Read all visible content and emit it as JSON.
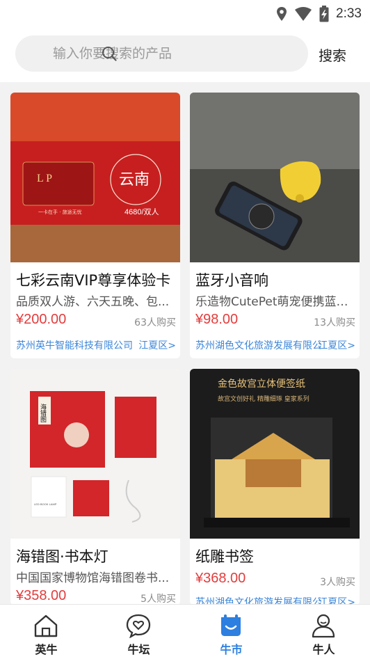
{
  "status_bar": {
    "time": "2:33"
  },
  "search": {
    "placeholder": "输入你要搜索的产品",
    "button_label": "搜索"
  },
  "products": [
    {
      "title": "七彩云南VIP尊享体验卡",
      "desc": "品质双人游、六天五晚、包...",
      "price": "¥200.00",
      "sold": "63人购买",
      "shop": "苏州英牛智能科技有限公司",
      "area": "江夏区>",
      "image_text": {
        "logo": "L P",
        "city": "云南",
        "price": "4680/双人",
        "slogan": "一卡在手 · 旅途无忧"
      }
    },
    {
      "title": "蓝牙小音响",
      "desc": "乐造物CutePet萌宠便携蓝牙...",
      "price": "¥98.00",
      "sold": "13人购买",
      "shop": "苏州湖色文化旅游发展有限公司",
      "area": "江夏区>"
    },
    {
      "title": "海错图·书本灯",
      "desc": "中国国家博物馆海错图卷书...",
      "price": "¥358.00",
      "sold": "5人购买",
      "shop": "",
      "area": "",
      "image_text": {
        "book": "海错图",
        "note": "LED BOOK LAMP"
      }
    },
    {
      "title": "纸雕书签",
      "desc": "",
      "price": "¥368.00",
      "sold": "3人购买",
      "shop": "苏州湖色文化旅游发展有限公司",
      "area": "江夏区>",
      "image_text": {
        "headline": "金色故宫立体便签纸",
        "tagline": "故宫文创好礼  精雕细琢  皇家系列"
      }
    }
  ],
  "tabs": [
    {
      "label": "英牛",
      "icon": "home-icon"
    },
    {
      "label": "牛坛",
      "icon": "heart-chat-icon"
    },
    {
      "label": "牛市",
      "icon": "shopping-bag-icon",
      "active": true
    },
    {
      "label": "牛人",
      "icon": "user-icon"
    }
  ],
  "colors": {
    "price": "#e33c3c",
    "link": "#3c86d8",
    "active_tab": "#2d7fe0"
  }
}
